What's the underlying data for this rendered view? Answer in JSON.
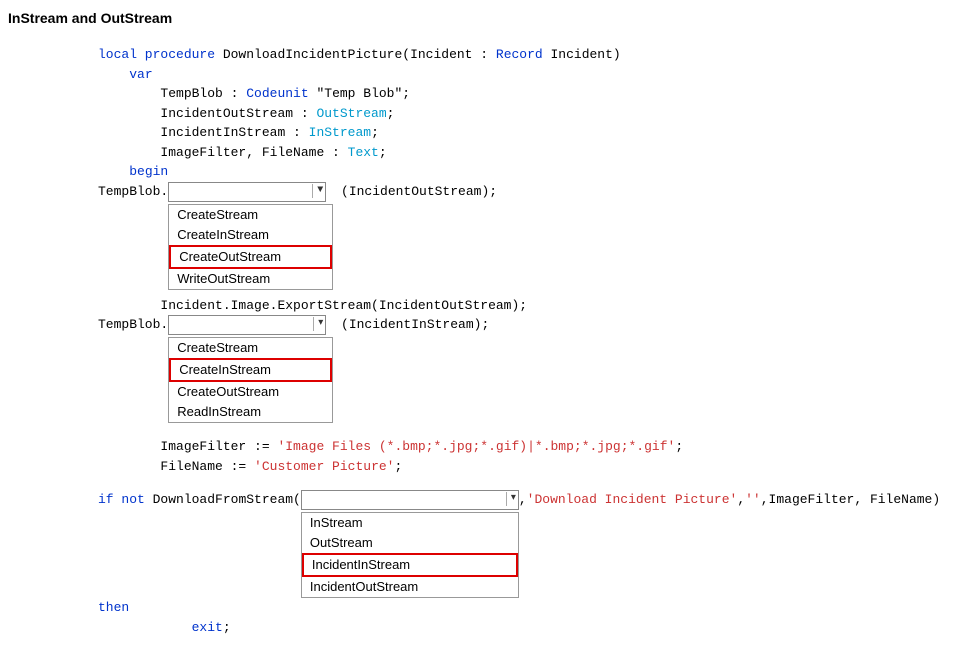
{
  "title": "InStream and OutStream",
  "code": {
    "l1a": "local procedure",
    "l1b": " DownloadIncidentPicture(Incident : ",
    "l1c": "Record",
    "l1d": " Incident)",
    "l2": "var",
    "l3a": "TempBlob : ",
    "l3b": "Codeunit",
    "l3c": " \"Temp Blob\";",
    "l4a": "IncidentOutStream : ",
    "l4b": "OutStream",
    "l4c": ";",
    "l5a": "IncidentInStream : ",
    "l5b": "InStream",
    "l5c": ";",
    "l6a": "ImageFilter, FileName : ",
    "l6b": "Text",
    "l6c": ";",
    "l7": "begin",
    "l8a": "TempBlob.",
    "l8b": " (IncidentOutStream);",
    "l9a": "Incident.Image.ExportStream(IncidentOutStream);",
    "l10a": "TempBlob.",
    "l10b": " (IncidentInStream);",
    "l11a": "ImageFilter := ",
    "l11b": "'Image Files (*.bmp;*.jpg;*.gif)|*.bmp;*.jpg;*.gif'",
    "l11c": ";",
    "l12a": "FileName := ",
    "l12b": "'Customer Picture'",
    "l12c": ";",
    "l13a": "if",
    "l13b": " not",
    "l13c": " DownloadFromStream(",
    "l13d": ",",
    "l13e": "'Download Incident Picture'",
    "l13f": ",",
    "l13g": "''",
    "l13h": ",ImageFilter, FileName) ",
    "l13i": "then",
    "l14": "exit",
    "l14b": ";"
  },
  "dd1": {
    "items": [
      "CreateStream",
      "CreateInStream",
      "CreateOutStream",
      "WriteOutStream"
    ],
    "highlight_index": 2
  },
  "dd2": {
    "items": [
      "CreateStream",
      "CreateInStream",
      "CreateOutStream",
      "ReadInStream"
    ],
    "highlight_index": 1
  },
  "dd3": {
    "items": [
      "InStream",
      "OutStream",
      "IncidentInStream",
      "IncidentOutStream"
    ],
    "highlight_index": 2
  }
}
